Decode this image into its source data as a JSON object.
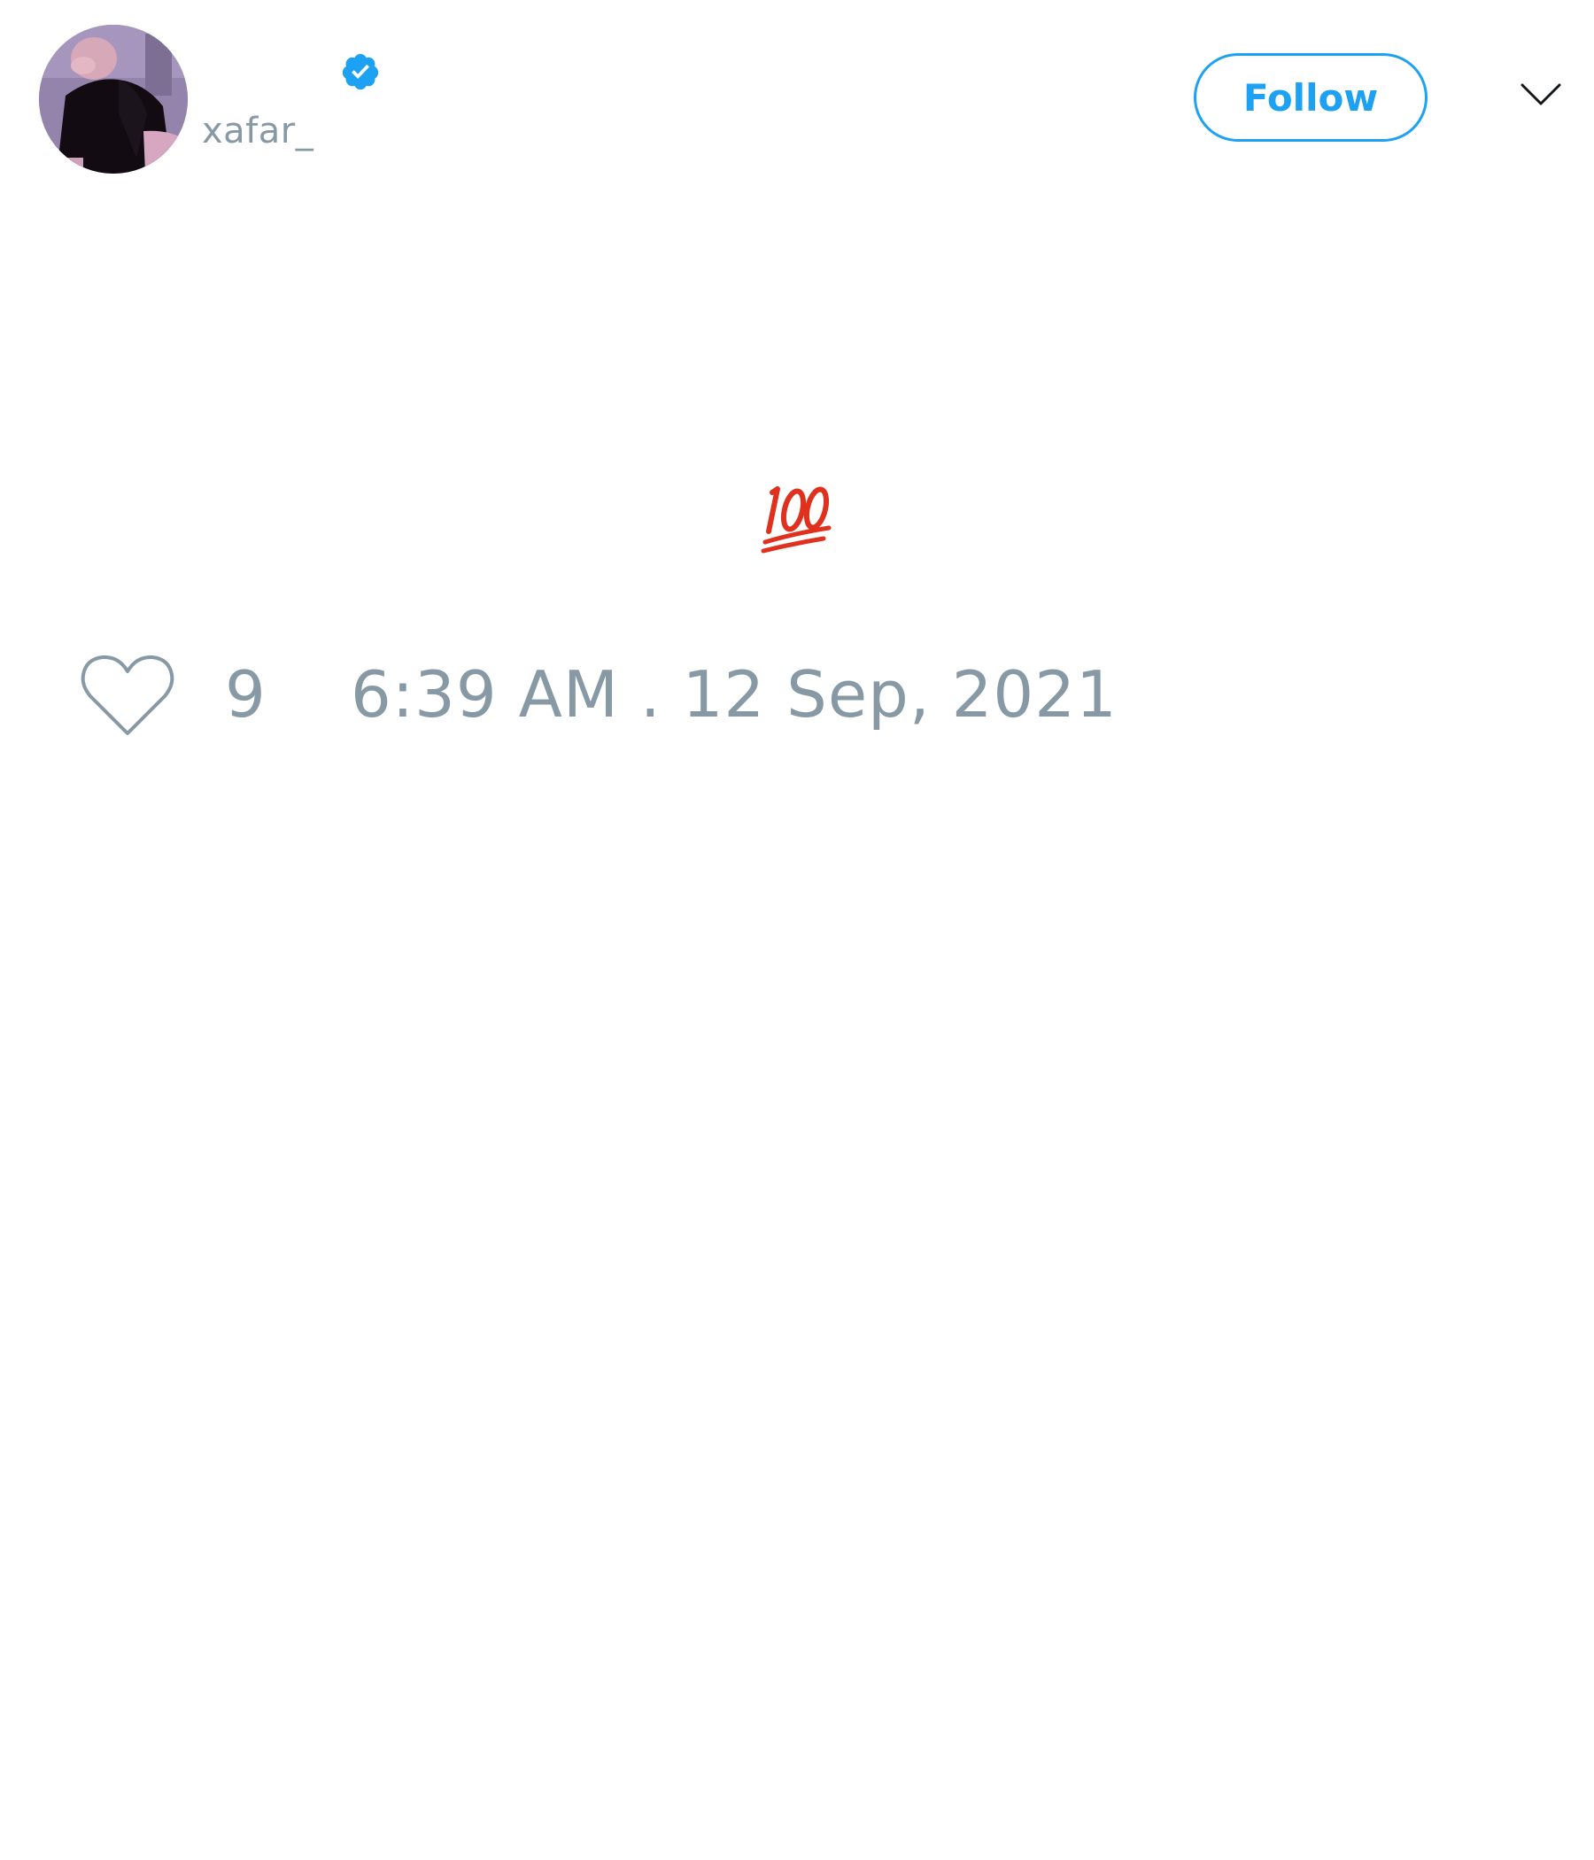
{
  "author": {
    "display_name": "",
    "handle": "xafar_",
    "verified": true,
    "avatar_icon": "profile-photo"
  },
  "actions": {
    "follow_label": "Follow",
    "menu_icon": "chevron-down-icon"
  },
  "tweet": {
    "text_emoji": "hundred-points-emoji",
    "likes": "9",
    "timestamp": "6:39 AM . 12 Sep, 2021"
  },
  "colors": {
    "accent": "#1da1f2",
    "muted_text": "#8899a6",
    "emoji_red": "#e0301e"
  }
}
